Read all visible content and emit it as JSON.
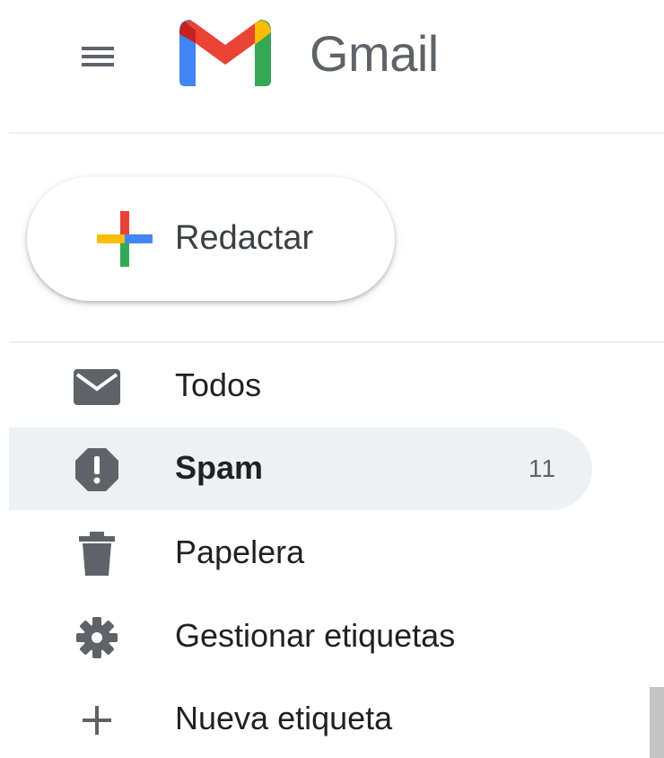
{
  "header": {
    "menu_icon": "hamburger-menu-icon",
    "logo_icon": "gmail-m-logo",
    "brand_text": "Gmail"
  },
  "compose": {
    "icon": "colored-plus-icon",
    "label": "Redactar"
  },
  "nav": {
    "items": [
      {
        "icon": "envelope-icon",
        "label": "Todos",
        "count": "",
        "active": false
      },
      {
        "icon": "spam-alert-icon",
        "label": "Spam",
        "count": "11",
        "active": true
      },
      {
        "icon": "trash-icon",
        "label": "Papelera",
        "count": "",
        "active": false
      },
      {
        "icon": "gear-icon",
        "label": "Gestionar etiquetas",
        "count": "",
        "active": false
      },
      {
        "icon": "plus-icon",
        "label": "Nueva etiqueta",
        "count": "",
        "active": false
      }
    ]
  },
  "colors": {
    "google_blue": "#4285f4",
    "google_red": "#ea4335",
    "google_yellow": "#fbbc04",
    "google_green": "#34a853",
    "icon_gray": "#5f6368",
    "active_bg": "#eef1f4"
  }
}
